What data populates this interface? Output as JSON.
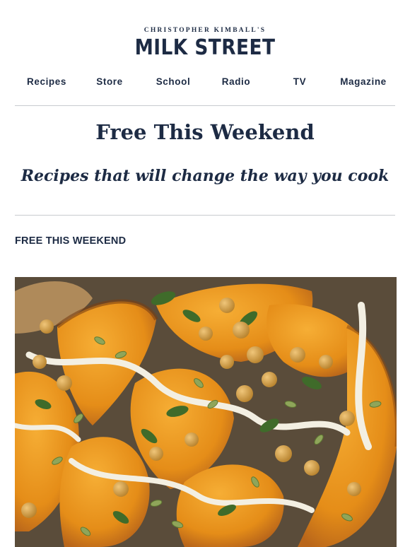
{
  "brand": {
    "kicker": "CHRISTOPHER KIMBALL'S",
    "name": "MILK STREET"
  },
  "nav": {
    "items": [
      {
        "label": "Recipes"
      },
      {
        "label": "Store"
      },
      {
        "label": "School"
      },
      {
        "label": "Radio"
      },
      {
        "label": "TV"
      },
      {
        "label": "Magazine"
      }
    ]
  },
  "hero_text": {
    "headline": "Free This Weekend",
    "tagline": "Recipes that will change the way you cook"
  },
  "section": {
    "label": "FREE THIS WEEKEND"
  },
  "colors": {
    "brand_navy": "#1d2b44",
    "divider": "#c8cbcf",
    "squash": "#e9951f",
    "chickpea": "#d4a04b",
    "pepita": "#8fa55a",
    "herb": "#3f6b2a",
    "tahini": "#f3efe2"
  },
  "hero_image": {
    "icon": "roasted-squash-photo"
  }
}
